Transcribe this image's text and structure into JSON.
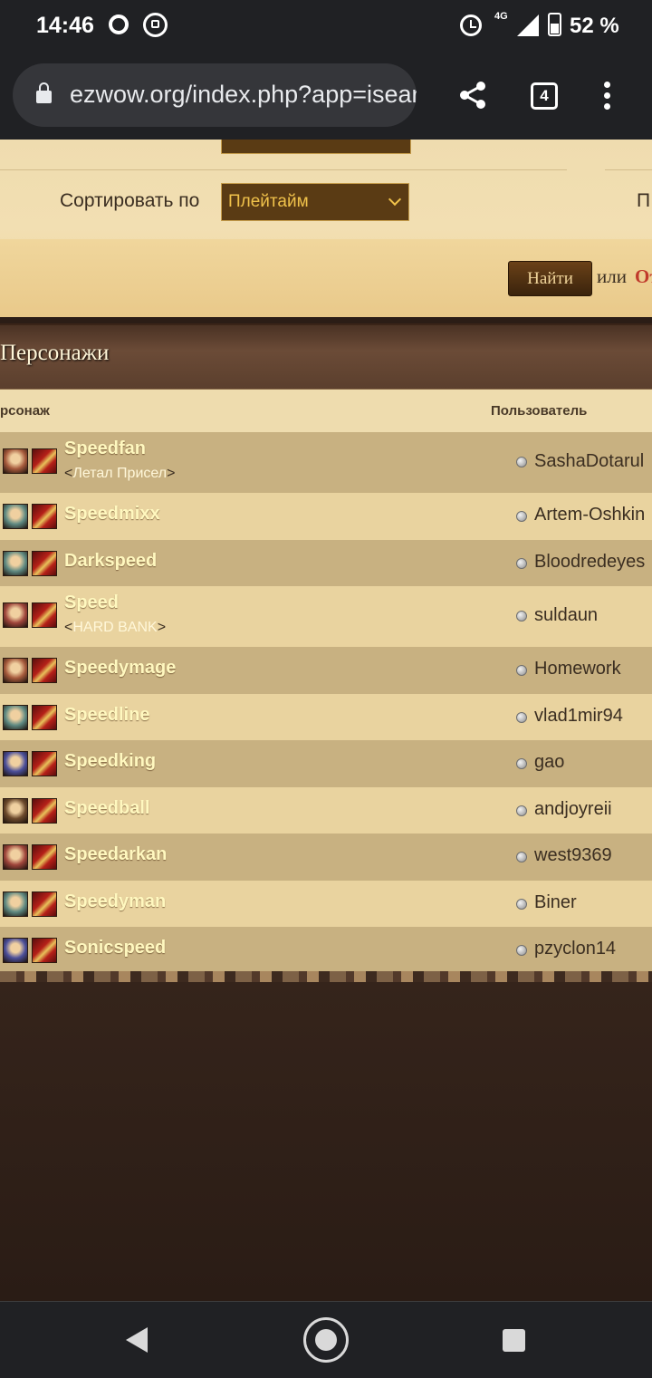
{
  "status_bar": {
    "time": "14:46",
    "network": "4G",
    "battery": "52 %"
  },
  "browser": {
    "url": "ezwow.org/index.php?app=isearch",
    "tab_count": "4"
  },
  "filters": {
    "sort_label": "Сортировать по",
    "sort_value": "Плейтайм",
    "cut_label": "П"
  },
  "actions": {
    "find_label": "Найти",
    "or_label": "или",
    "cancel_label": "От"
  },
  "section": {
    "title": "Персонажи"
  },
  "table": {
    "col_character": "рсонаж",
    "col_user": "Пользователь",
    "rows": [
      {
        "name": "Speedfan",
        "guild": "Летал Присел",
        "user": "SashaDotarul",
        "race_color": "#a65a3c"
      },
      {
        "name": "Speedmixx",
        "guild": "",
        "user": "Artem-Oshkin",
        "race_color": "#5f8a82"
      },
      {
        "name": "Darkspeed",
        "guild": "",
        "user": "Bloodredeyes",
        "race_color": "#5f8a82"
      },
      {
        "name": "Speed",
        "guild": "HARD BANK",
        "user": "suldaun",
        "race_color": "#a0463c"
      },
      {
        "name": "Speedymage",
        "guild": "",
        "user": "Homework",
        "race_color": "#a65a3c"
      },
      {
        "name": "Speedline",
        "guild": "",
        "user": "vlad1mir94",
        "race_color": "#5f8a82"
      },
      {
        "name": "Speedking",
        "guild": "",
        "user": "gao",
        "race_color": "#4b4f9a"
      },
      {
        "name": "Speedball",
        "guild": "",
        "user": "andjoyreii",
        "race_color": "#6d4a2c"
      },
      {
        "name": "Speedarkan",
        "guild": "",
        "user": "west9369",
        "race_color": "#a0463c"
      },
      {
        "name": "Speedyman",
        "guild": "",
        "user": "Biner",
        "race_color": "#5f8a82"
      },
      {
        "name": "Sonicspeed",
        "guild": "",
        "user": "pzyclon14",
        "race_color": "#4b4f9a"
      }
    ]
  }
}
